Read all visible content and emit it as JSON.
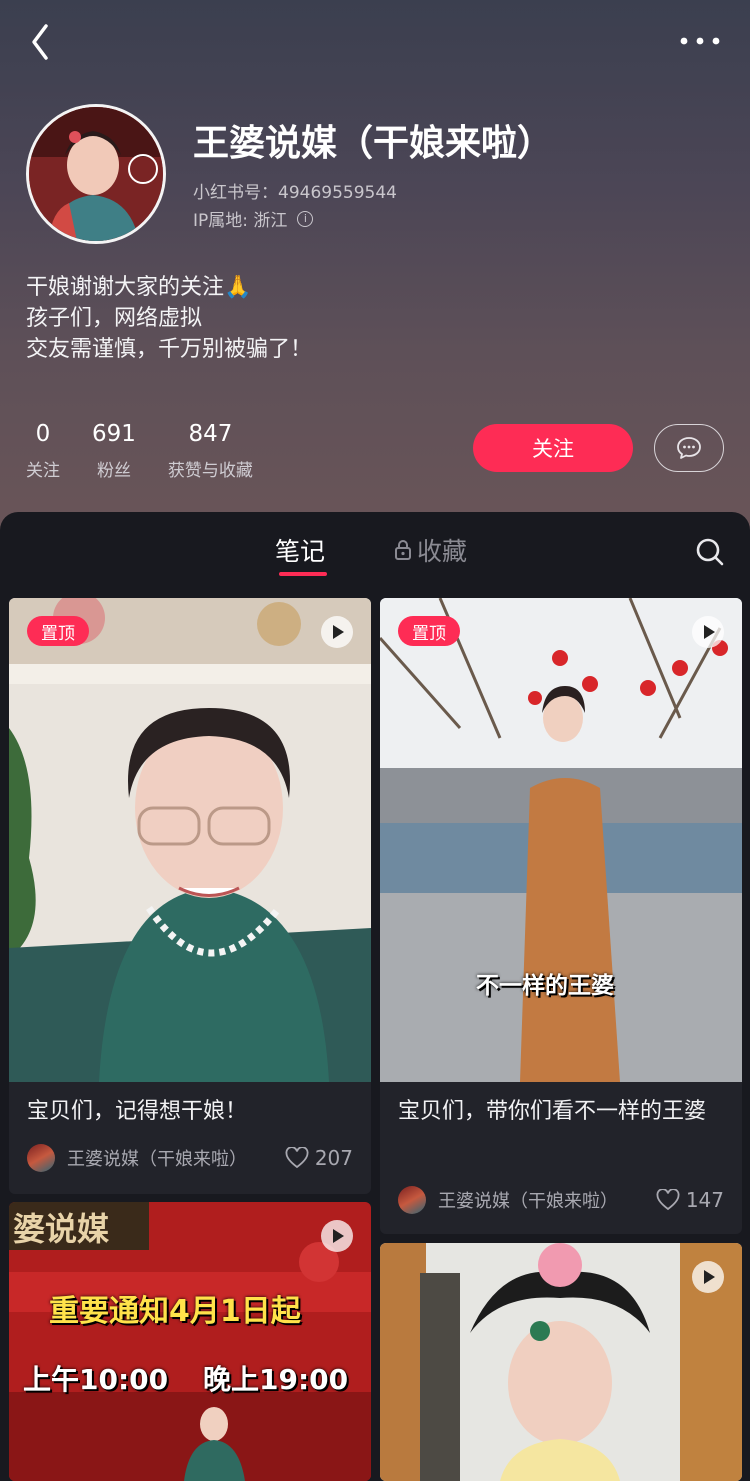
{
  "profile": {
    "nickname": "王婆说媒（干娘来啦）",
    "red_id": "小红书号：49469559544",
    "ip_location": "IP属地: 浙江",
    "bio_lines": [
      "干娘谢谢大家的关注🙏",
      "孩子们，网络虚拟",
      "交友需谨慎，千万别被骗了！"
    ],
    "stats": [
      {
        "value": "0",
        "label": "关注"
      },
      {
        "value": "691",
        "label": "粉丝"
      },
      {
        "value": "847",
        "label": "获赞与收藏"
      }
    ],
    "follow_label": "关注"
  },
  "tabs": {
    "notes": "笔记",
    "collections": "收藏"
  },
  "notes": [
    {
      "pinned_label": "置顶",
      "title": "宝贝们，记得想干娘！",
      "author": "王婆说媒（干娘来啦）",
      "likes": "207"
    },
    {
      "pinned_label": "置顶",
      "title": "宝贝们，带你们看不一样的王婆",
      "author": "王婆说媒（干娘来啦）",
      "likes": "147",
      "overlay": "不一样的王婆"
    },
    {
      "sign": "婆说媒",
      "overlay_line1": "重要通知4月1日起",
      "overlay_line2a": "上午10:00",
      "overlay_line2b": "晚上19:00"
    },
    {}
  ],
  "colors": {
    "accent": "#fe2c55",
    "panel_bg": "#18191f",
    "card_bg": "#22232a"
  }
}
